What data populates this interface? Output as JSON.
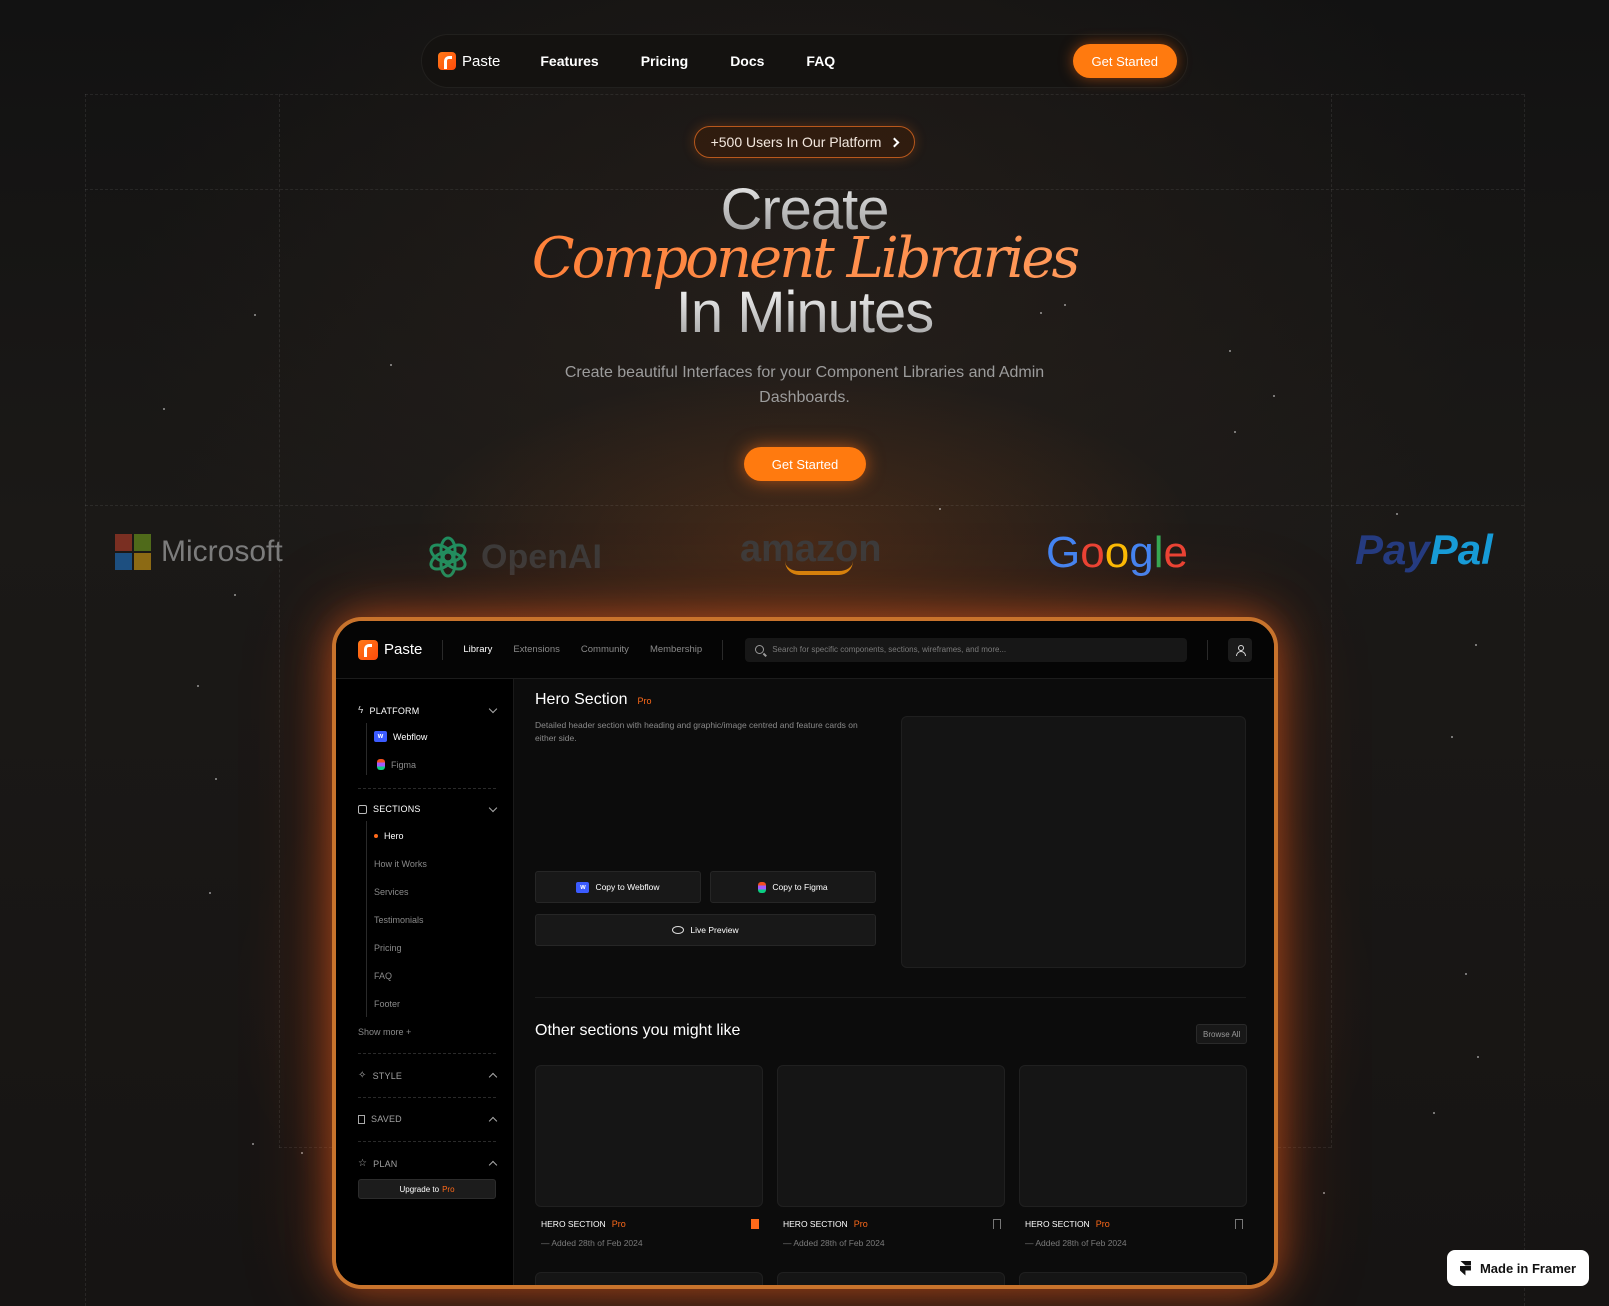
{
  "nav": {
    "brand": "Paste",
    "links": [
      "Features",
      "Pricing",
      "Docs",
      "FAQ"
    ],
    "cta": "Get Started"
  },
  "hero": {
    "badge": "+500 Users In Our Platform",
    "line1": "Create",
    "line2": "Component Libraries",
    "line3": "In Minutes",
    "subtitle": "Create beautiful Interfaces for your Component Libraries and Admin Dashboards.",
    "cta": "Get Started"
  },
  "logos": {
    "microsoft": "Microsoft",
    "openai": "OpenAI",
    "amazon": "amazon",
    "google": [
      "G",
      "o",
      "o",
      "g",
      "l",
      "e"
    ],
    "google_colors": [
      "#4285F4",
      "#EA4335",
      "#FBBC05",
      "#4285F4",
      "#34A853",
      "#EA4335"
    ],
    "paypal_a": "Pay",
    "paypal_b": "Pal",
    "paypal_colors": [
      "#253b80",
      "#179bd7"
    ]
  },
  "app": {
    "brand": "Paste",
    "links": [
      "Library",
      "Extensions",
      "Community",
      "Membership"
    ],
    "search_placeholder": "Search for specific components, sections, wireframes, and more...",
    "sidebar": {
      "platform": "PLATFORM",
      "platform_items": [
        "Webflow",
        "Figma"
      ],
      "sections": "SECTIONS",
      "section_items": [
        "Hero",
        "How it Works",
        "Services",
        "Testimonials",
        "Pricing",
        "FAQ",
        "Footer"
      ],
      "show_more": "Show more +",
      "style": "STYLE",
      "saved": "SAVED",
      "plan": "PLAN",
      "upgrade": "Upgrade to",
      "upgrade_pro": "Pro"
    },
    "main": {
      "title": "Hero Section",
      "pro": "Pro",
      "description": "Detailed header section with heading and graphic/image centred and feature cards on either side.",
      "copy_webflow": "Copy to Webflow",
      "copy_figma": "Copy to Figma",
      "live_preview": "Live Preview",
      "other_title": "Other sections you might like",
      "browse_all": "Browse All",
      "cards": [
        {
          "label": "HERO SECTION",
          "pro": "Pro",
          "date": "— Added 28th of Feb 2024",
          "saved": true
        },
        {
          "label": "HERO SECTION",
          "pro": "Pro",
          "date": "— Added 28th of Feb 2024",
          "saved": false
        },
        {
          "label": "HERO SECTION",
          "pro": "Pro",
          "date": "— Added 28th of Feb 2024",
          "saved": false
        }
      ]
    }
  },
  "framer_badge": "Made in Framer",
  "colors": {
    "accent": "#ff7a0f",
    "frame_border": "#c8732c"
  }
}
